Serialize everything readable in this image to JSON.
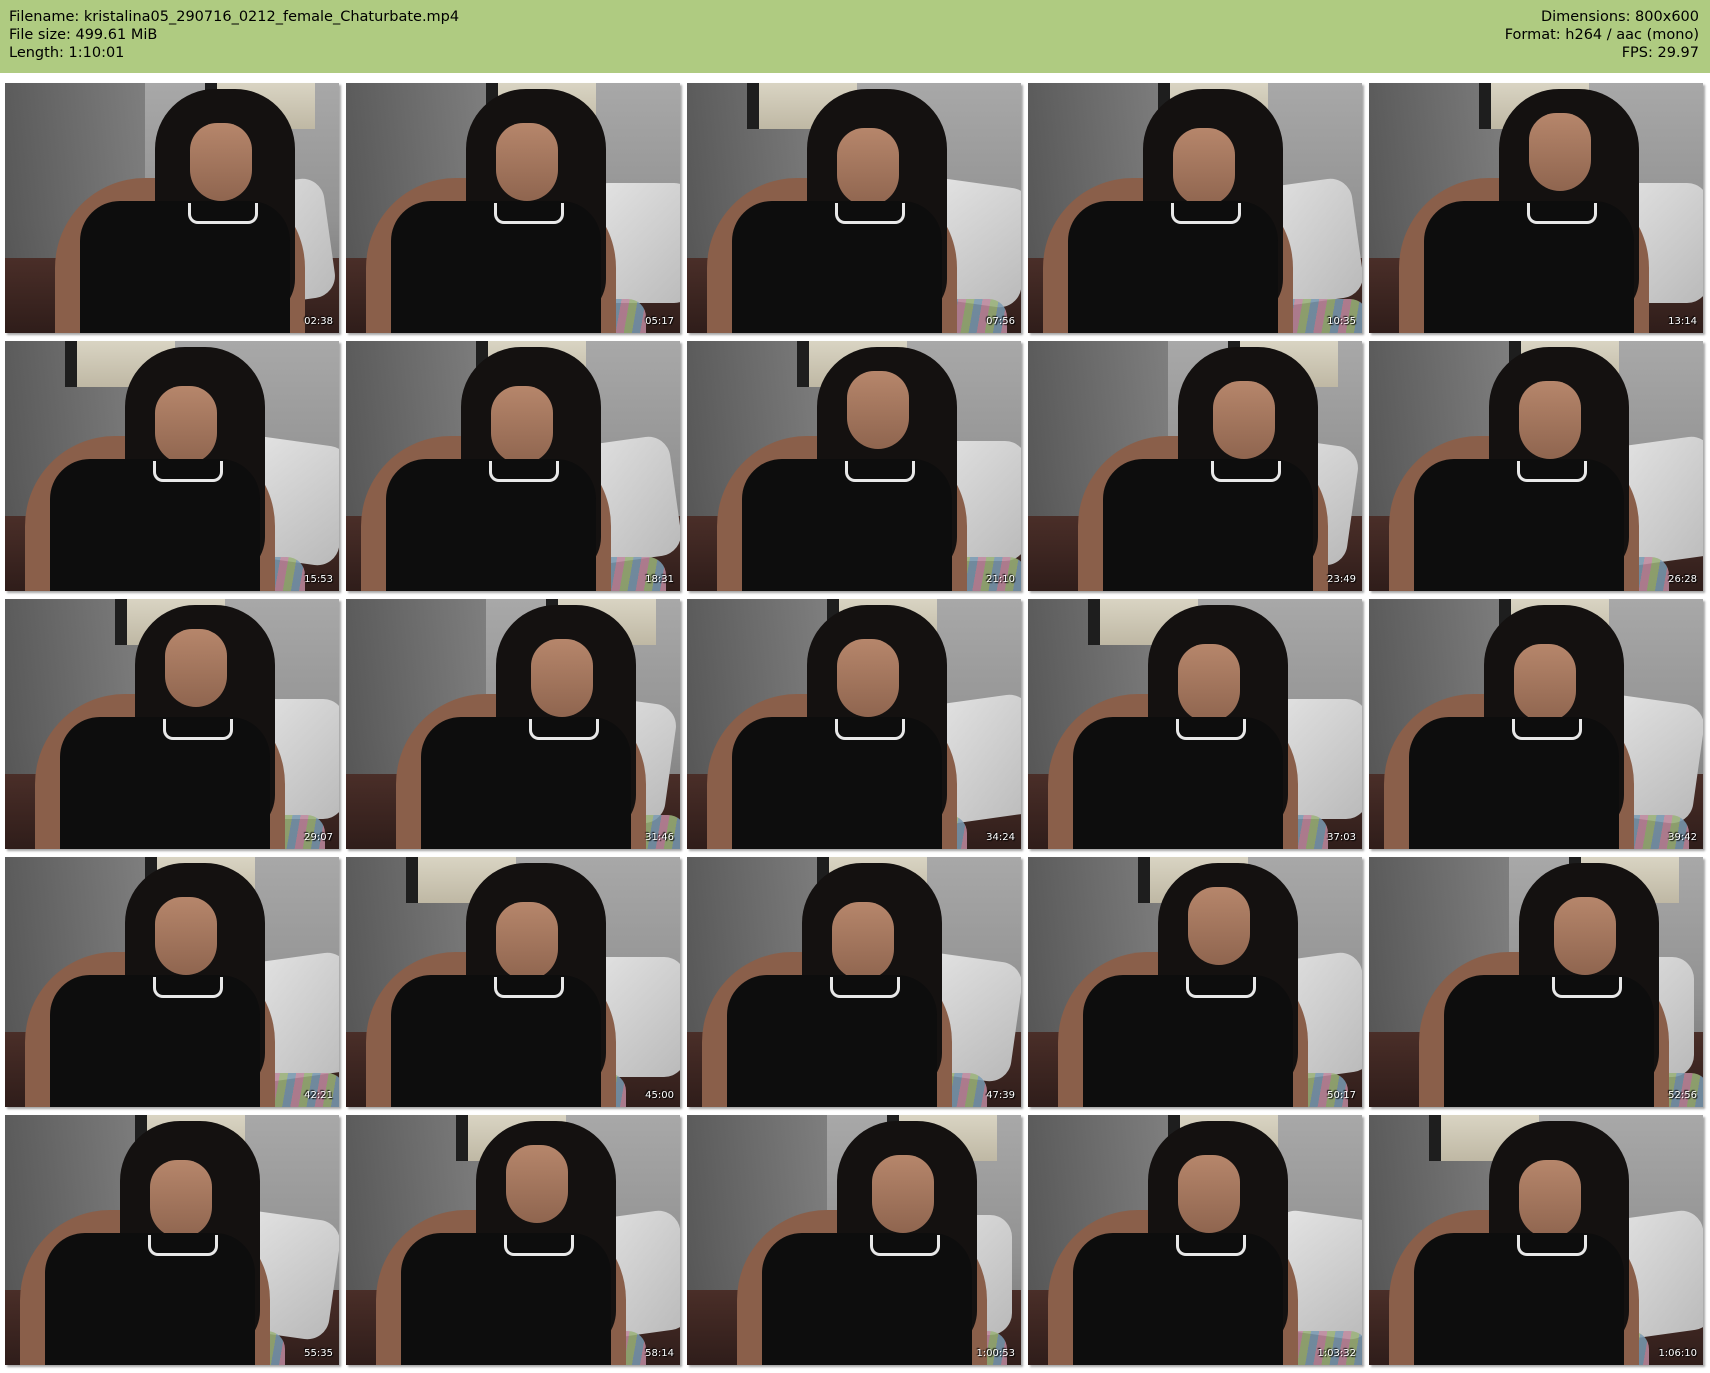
{
  "header": {
    "filename": "Filename: kristalina05_290716_0212_female_Chaturbate.mp4",
    "filesize": "File size: 499.61 MiB",
    "length": "Length: 1:10:01",
    "dimensions": "Dimensions: 800x600",
    "format": "Format: h264 / aac (mono)",
    "fps": "FPS: 29.97"
  },
  "thumbnails": [
    {
      "timestamp": "02:38"
    },
    {
      "timestamp": "05:17"
    },
    {
      "timestamp": "07:56"
    },
    {
      "timestamp": "10:35"
    },
    {
      "timestamp": "13:14"
    },
    {
      "timestamp": "15:53"
    },
    {
      "timestamp": "18:31"
    },
    {
      "timestamp": "21:10"
    },
    {
      "timestamp": "23:49"
    },
    {
      "timestamp": "26:28"
    },
    {
      "timestamp": "29:07"
    },
    {
      "timestamp": "31:46"
    },
    {
      "timestamp": "34:24"
    },
    {
      "timestamp": "37:03"
    },
    {
      "timestamp": "39:42"
    },
    {
      "timestamp": "42:21"
    },
    {
      "timestamp": "45:00"
    },
    {
      "timestamp": "47:39"
    },
    {
      "timestamp": "50:17"
    },
    {
      "timestamp": "52:56"
    },
    {
      "timestamp": "55:35"
    },
    {
      "timestamp": "58:14"
    },
    {
      "timestamp": "1:00:53"
    },
    {
      "timestamp": "1:03:32"
    },
    {
      "timestamp": "1:06:10"
    }
  ],
  "colors": {
    "header_background": "#afcb81",
    "page_background": "#ffffff",
    "timestamp_text": "#ffffff"
  }
}
